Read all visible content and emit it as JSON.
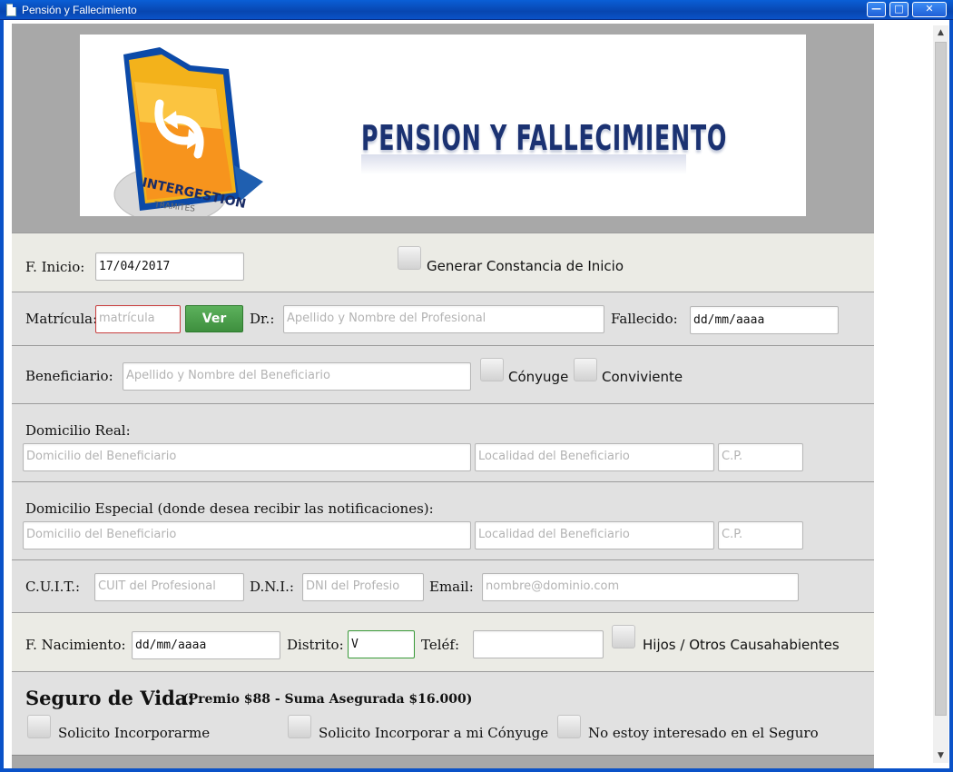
{
  "window": {
    "title": "Pensión y Fallecimiento",
    "min_glyph": "—",
    "max_glyph": "□",
    "close_glyph": "✕"
  },
  "banner": {
    "title": "PENSION Y FALLECIMIENTO",
    "logo_text": "INTERGESTION",
    "logo_subtext": "TRAMITES"
  },
  "form": {
    "inicio": {
      "label": "F. Inicio:",
      "value": "17/04/2017"
    },
    "constancia": {
      "label": "Generar Constancia de Inicio"
    },
    "matricula": {
      "label": "Matrícula:",
      "placeholder": "matrícula",
      "button": "Ver"
    },
    "dr": {
      "label": "Dr.:",
      "placeholder": "Apellido y Nombre del Profesional"
    },
    "fallecido": {
      "label": "Fallecido:",
      "value": "dd/mm/aaaa"
    },
    "beneficiario": {
      "label": "Beneficiario:",
      "placeholder": "Apellido y Nombre del Beneficiario"
    },
    "conyuge": {
      "label": "Cónyuge"
    },
    "conviviente": {
      "label": "Conviviente"
    },
    "domicilio_real": {
      "label": "Domicilio Real:",
      "domicilio_placeholder": "Domicilio del Beneficiario",
      "localidad_placeholder": "Localidad del Beneficiario",
      "cp_placeholder": "C.P."
    },
    "domicilio_especial": {
      "label": "Domicilio Especial (donde desea recibir las notificaciones):",
      "domicilio_placeholder": "Domicilio del Beneficiario",
      "localidad_placeholder": "Localidad del Beneficiario",
      "cp_placeholder": "C.P."
    },
    "cuit": {
      "label": "C.U.I.T.:",
      "placeholder": "CUIT del Profesional"
    },
    "dni": {
      "label": "D.N.I.:",
      "placeholder": "DNI del Profesio"
    },
    "email": {
      "label": "Email:",
      "placeholder": "nombre@dominio.com"
    },
    "nacimiento": {
      "label": "F. Nacimiento:",
      "value": "dd/mm/aaaa"
    },
    "distrito": {
      "label": "Distrito:",
      "value": "V"
    },
    "telefono": {
      "label": "Teléf:",
      "value": ""
    },
    "hijos": {
      "label": "Hijos / Otros Causahabientes"
    },
    "seguro": {
      "title": "Seguro de Vida:",
      "subtitle": "(Premio $88 - Suma Asegurada $16.000)",
      "opt1": "Solicito Incorporarme",
      "opt2": "Solicito Incorporar a mi Cónyuge",
      "opt3": "No estoy interesado en el Seguro"
    }
  },
  "scrollbar": {
    "up_glyph": "▲",
    "down_glyph": "▼"
  },
  "colors": {
    "title_bar": "#0a52c8",
    "banner_text": "#1b3272",
    "ver_button": "#4a9e4a",
    "error_border": "#c94040",
    "valid_border": "#3a9b3a"
  }
}
